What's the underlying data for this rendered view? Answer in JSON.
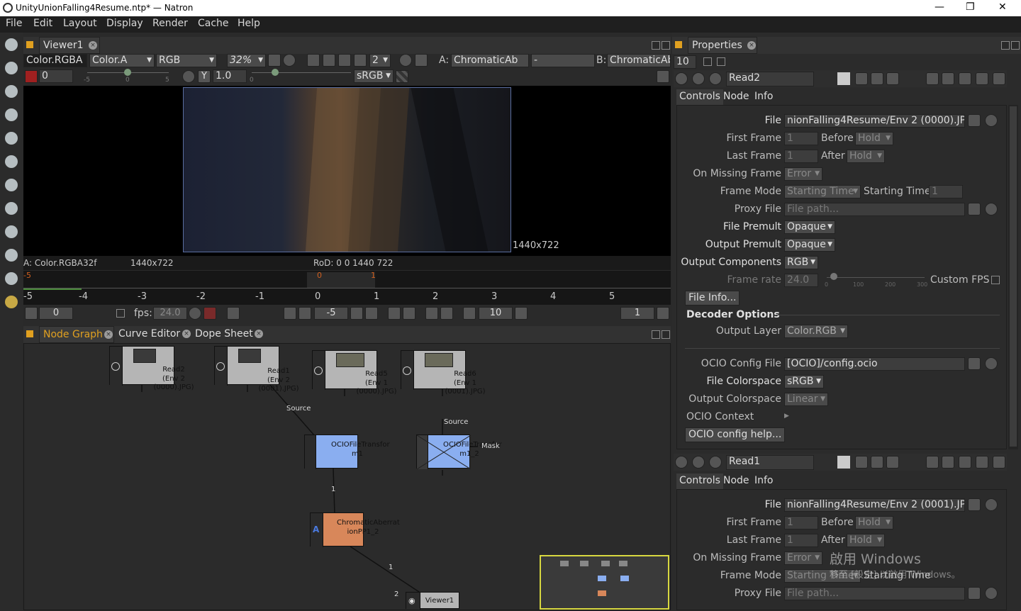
{
  "window": {
    "title": "UnityUnionFalling4Resume.ntp* — Natron",
    "minimize": "—",
    "maximize": "❐",
    "close": "✕"
  },
  "menu": [
    "File",
    "Edit",
    "Layout",
    "Display",
    "Render",
    "Cache",
    "Help"
  ],
  "viewer": {
    "tab": "Viewer1",
    "layer": "Color.RGBA",
    "alpha": "Color.A",
    "channels": "RGB",
    "zoom": "32%",
    "mip": "2",
    "input_a_label": "A:",
    "input_a": "ChromaticAb",
    "op": "-",
    "input_b_label": "B:",
    "input_b": "ChromaticAb",
    "gain": "0",
    "gain_ticks": [
      "-5",
      "0",
      "5"
    ],
    "gamma": "1.0",
    "gamma_ticks": [
      "0"
    ],
    "gamma_label": "Y",
    "colorspace": "sRGB",
    "res_label": "1440x722",
    "info_format": "A: Color.RGBA32f",
    "info_res": "1440x722",
    "info_rod": "RoD: 0 0 1440 722"
  },
  "timeline": {
    "ticks": [
      "-5",
      "-4",
      "-3",
      "-2",
      "-1",
      "0",
      "1",
      "2",
      "3",
      "4",
      "5"
    ],
    "marker_left": "-5",
    "marker_in": "0",
    "marker_out": "1"
  },
  "playback": {
    "frame": "0",
    "fps_label": "fps:",
    "fps": "24.0",
    "step": "-5",
    "increment": "10",
    "current": "1"
  },
  "nodegraph_tabs": [
    {
      "label": "Node Graph"
    },
    {
      "label": "Curve Editor"
    },
    {
      "label": "Dope Sheet"
    }
  ],
  "nodes": {
    "read2": {
      "name": "Read2",
      "file": "(Env 2 (0000).JPG)"
    },
    "read1": {
      "name": "Read1",
      "file": "(Env 2 (0001).JPG)"
    },
    "read5": {
      "name": "Read5",
      "file": "(Env 1 (0000).JPG)"
    },
    "read6": {
      "name": "Read6",
      "file": "(Env 1 (0001).JPG)"
    },
    "ocio1": {
      "name1": "OCIOFileTransfor",
      "name2": "m1"
    },
    "ocio2": {
      "name1": "OCIOFileTransfor",
      "name2": "m1_2"
    },
    "chroma": {
      "name1": "ChromaticAberrat",
      "name2": "ionPP1_2"
    },
    "viewer": {
      "name": "Viewer1"
    },
    "labels": {
      "source1": "Source",
      "source2": "Source",
      "mask": "Mask",
      "edge1": "1",
      "edge2": "1",
      "edge3": "2"
    }
  },
  "properties": {
    "tab": "Properties",
    "max_panels": "10",
    "read2": {
      "name": "Read2",
      "tabs": [
        "Controls",
        "Node",
        "Info"
      ],
      "file_label": "File",
      "file": "nionFalling4Resume/Env 2 (0000).JPG",
      "first_frame_label": "First Frame",
      "first_frame": "1",
      "before_label": "Before",
      "before": "Hold",
      "last_frame_label": "Last Frame",
      "last_frame": "1",
      "after_label": "After",
      "after": "Hold",
      "missing_label": "On Missing Frame",
      "missing": "Error",
      "frame_mode_label": "Frame Mode",
      "frame_mode": "Starting Time",
      "starting_time_label": "Starting Time",
      "starting_time": "1",
      "proxy_label": "Proxy File",
      "proxy_placeholder": "File path...",
      "file_premult_label": "File Premult",
      "file_premult": "Opaque",
      "output_premult_label": "Output Premult",
      "output_premult": "Opaque",
      "output_comp_label": "Output Components",
      "output_comp": "RGB",
      "frame_rate_label": "Frame rate",
      "frame_rate": "24.0",
      "frame_rate_ticks": [
        "0",
        "100",
        "200",
        "300"
      ],
      "custom_fps_label": "Custom FPS",
      "file_info_btn": "File Info...",
      "decoder_label": "Decoder Options",
      "output_layer_label": "Output Layer",
      "output_layer": "Color.RGB",
      "ocio_config_label": "OCIO Config File",
      "ocio_config": "[OCIO]/config.ocio",
      "file_cs_label": "File Colorspace",
      "file_cs": "sRGB",
      "output_cs_label": "Output Colorspace",
      "output_cs": "Linear",
      "ocio_context_label": "OCIO Context",
      "ocio_help_btn": "OCIO config help..."
    },
    "read1": {
      "name": "Read1",
      "tabs": [
        "Controls",
        "Node",
        "Info"
      ],
      "file_label": "File",
      "file": "nionFalling4Resume/Env 2 (0001).JPG",
      "first_frame_label": "First Frame",
      "first_frame": "1",
      "before_label": "Before",
      "before": "Hold",
      "last_frame_label": "Last Frame",
      "last_frame": "1",
      "after_label": "After",
      "after": "Hold",
      "missing_label": "On Missing Frame",
      "missing": "Error",
      "frame_mode_label": "Frame Mode",
      "frame_mode": "Starting Time",
      "starting_time_label": "Starting Time",
      "proxy_label": "Proxy File",
      "proxy_placeholder": "File path..."
    }
  },
  "watermark": {
    "line1": "啟用 Windows",
    "line2": "移至 [設定] 以啟用 Windows。"
  }
}
